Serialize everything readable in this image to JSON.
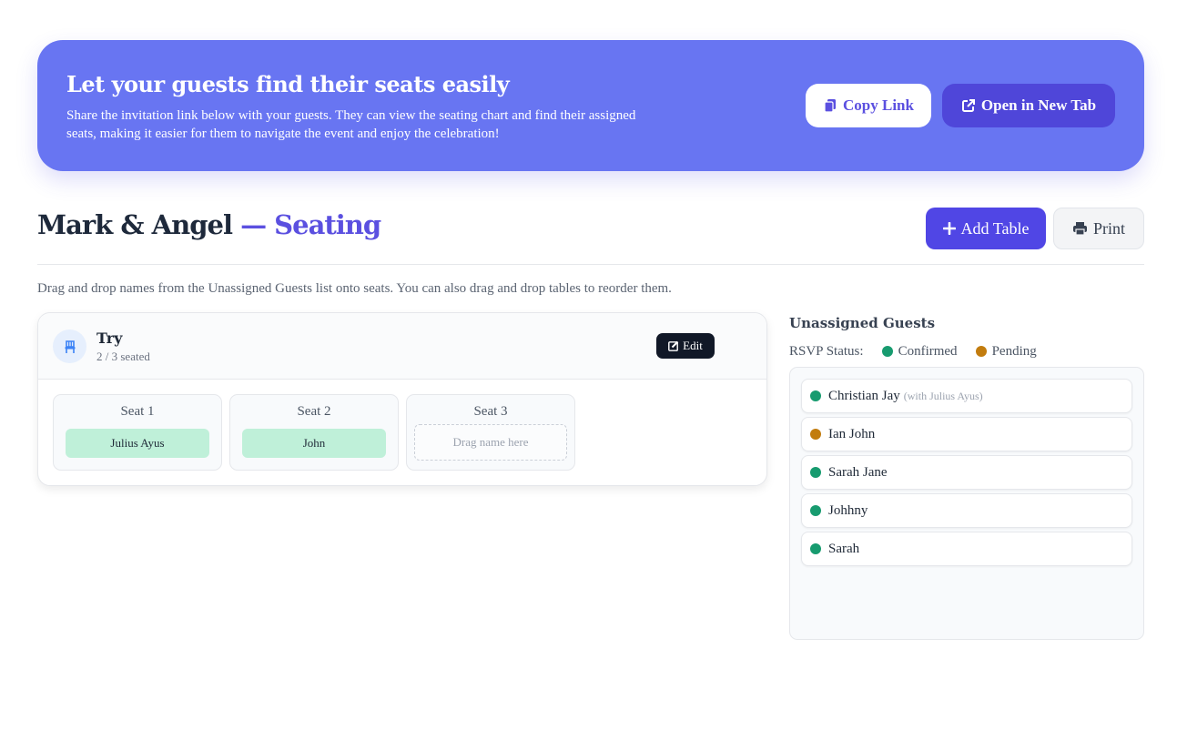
{
  "banner": {
    "title": "Let your guests find their seats easily",
    "description": "Share the invitation link below with your guests. They can view the seating chart and find their assigned seats, making it easier for them to navigate the event and enjoy the celebration!",
    "copy_label": "Copy Link",
    "open_label": "Open in New Tab"
  },
  "page": {
    "title_names": "Mark & Angel",
    "title_accent": "— Seating",
    "add_table_label": "Add Table",
    "print_label": "Print",
    "hint": "Drag and drop names from the Unassigned Guests list onto seats. You can also drag and drop tables to reorder them."
  },
  "table": {
    "name": "Try",
    "count": "2 / 3 seated",
    "edit_label": "Edit",
    "seats": [
      {
        "label": "Seat 1",
        "guest": "Julius Ayus"
      },
      {
        "label": "Seat 2",
        "guest": "John"
      },
      {
        "label": "Seat 3",
        "placeholder": "Drag name here"
      }
    ]
  },
  "sidebar": {
    "title": "Unassigned Guests",
    "rsvp_label": "RSVP Status:",
    "confirmed_label": "Confirmed",
    "pending_label": "Pending",
    "guests": [
      {
        "name": "Christian Jay",
        "note": "(with Julius Ayus)",
        "status": "confirmed"
      },
      {
        "name": "Ian John",
        "status": "pending"
      },
      {
        "name": "Sarah Jane",
        "status": "confirmed"
      },
      {
        "name": "Johhny",
        "status": "confirmed"
      },
      {
        "name": "Sarah",
        "status": "confirmed"
      }
    ]
  },
  "colors": {
    "accent": "#5b50e0",
    "banner": "#6875f2",
    "confirmed": "#179b6f",
    "pending": "#c27c0e",
    "seated_chip": "#bff0d9"
  },
  "icons": [
    "copy-icon",
    "external-link-icon",
    "plus-icon",
    "printer-icon",
    "chair-icon",
    "edit-icon"
  ]
}
